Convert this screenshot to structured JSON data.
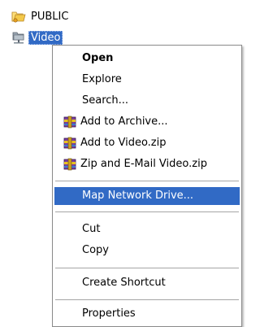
{
  "tree": {
    "items": [
      {
        "label": "PUBLIC",
        "icon": "folder-icon"
      },
      {
        "label": "Video",
        "icon": "network-folder-icon",
        "selected": true
      }
    ]
  },
  "context_menu": {
    "items": [
      {
        "label": "Open",
        "bold": true
      },
      {
        "label": "Explore"
      },
      {
        "label": "Search..."
      },
      {
        "label": "Add to Archive...",
        "icon": "winrar-archive-icon"
      },
      {
        "label": "Add to Video.zip",
        "icon": "winrar-archive-icon"
      },
      {
        "label": "Zip and E-Mail Video.zip",
        "icon": "winrar-archive-icon"
      },
      {
        "label": "Map Network Drive...",
        "highlighted": true
      },
      {
        "label": "Cut"
      },
      {
        "label": "Copy"
      },
      {
        "label": "Create Shortcut"
      },
      {
        "label": "Properties"
      }
    ]
  },
  "colors": {
    "selection": "#316ac5",
    "menu_border": "#8a8a8a",
    "separator": "#a6a6a6"
  }
}
